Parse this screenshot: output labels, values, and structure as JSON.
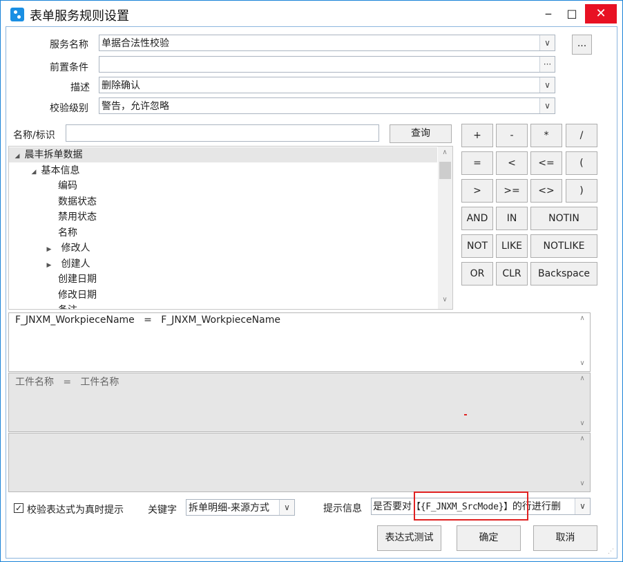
{
  "window": {
    "title": "表单服务规则设置",
    "minimize": "‒",
    "maximize": "□",
    "close": "✕"
  },
  "form": {
    "service_name_label": "服务名称",
    "service_name_value": "单据合法性校验",
    "precondition_label": "前置条件",
    "precondition_value": "",
    "description_label": "描述",
    "description_value": "删除确认",
    "level_label": "校验级别",
    "level_value": "警告，允许忽略",
    "ellipsis": "...",
    "dots": "···",
    "dd_arrow": "∨"
  },
  "search": {
    "label": "名称/标识",
    "value": "",
    "button": "查询"
  },
  "tree": {
    "items": [
      {
        "label": "晨丰拆单数据",
        "toggle": "◢"
      },
      {
        "label": "基本信息",
        "toggle": "◢"
      },
      {
        "label": "编码",
        "toggle": ""
      },
      {
        "label": "数据状态",
        "toggle": ""
      },
      {
        "label": "禁用状态",
        "toggle": ""
      },
      {
        "label": "名称",
        "toggle": ""
      },
      {
        "label": "修改人",
        "toggle": "▶"
      },
      {
        "label": "创建人",
        "toggle": "▶"
      },
      {
        "label": "创建日期",
        "toggle": ""
      },
      {
        "label": "修改日期",
        "toggle": ""
      },
      {
        "label": "备注",
        "toggle": ""
      }
    ],
    "scroll_up": "∧",
    "scroll_down": "∨"
  },
  "operators": {
    "plus": "+",
    "minus": "-",
    "mul": "*",
    "div": "/",
    "eq": "=",
    "lt": "<",
    "le": "<=",
    "lparen": "(",
    "gt": ">",
    "ge": ">=",
    "ne": "<>",
    "rparen": ")",
    "and": "AND",
    "in": "IN",
    "notin": "NOTIN",
    "not": "NOT",
    "like": "LIKE",
    "notlike": "NOTLIKE",
    "or": "OR",
    "clr": "CLR",
    "backspace": "Backspace"
  },
  "expression": {
    "text": "F_JNXM_WorkpieceName   =   F_JNXM_WorkpieceName",
    "display": "工件名称   =   工件名称",
    "extra": ""
  },
  "bottom": {
    "realtime_check_label": "校验表达式为真时提示",
    "realtime_checked": "✓",
    "keyword_label": "关键字",
    "keyword_value": "拆单明细-来源方式",
    "hint_label": "提示信息",
    "hint_prefix": "是否要对",
    "hint_highlight": "【{F_JNXM_SrcMode}】",
    "hint_suffix": "的行进行删",
    "test_button": "表达式测试",
    "ok_button": "确定",
    "cancel_button": "取消"
  }
}
